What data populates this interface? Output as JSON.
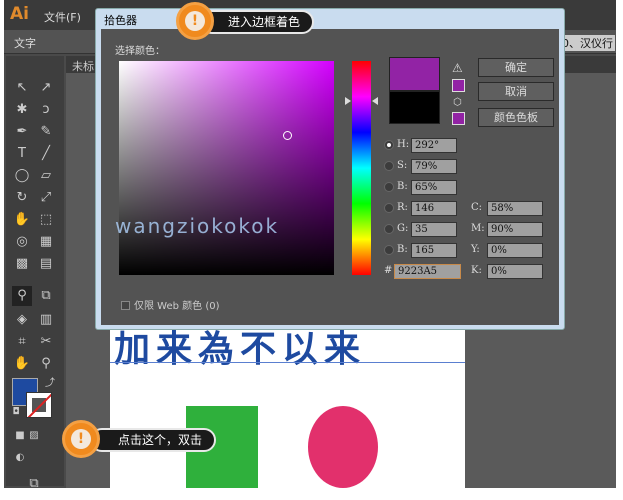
{
  "app": {
    "logo": "Ai",
    "menu_file": "文件(F)",
    "control_label": "文字",
    "font_field": "0、汉仪行",
    "doc_tab": "未标"
  },
  "canvas": {
    "text": "加来為不以来"
  },
  "dialog": {
    "title": "拾色器",
    "select_label": "选择颜色：",
    "ok": "确定",
    "cancel": "取消",
    "swatches": "颜色色板",
    "fields": {
      "H": "292°",
      "S": "79%",
      "B": "65%",
      "R": "146",
      "G": "35",
      "Bl": "165",
      "C": "58%",
      "M": "90%",
      "Y": "0%",
      "K": "0%",
      "hex": "9223A5"
    },
    "labels": {
      "H": "H:",
      "S": "S:",
      "B": "B:",
      "R": "R:",
      "G": "G:",
      "Bl": "B:",
      "C": "C:",
      "M": "M:",
      "Y": "Y:",
      "K": "K:",
      "hash": "#"
    },
    "web_only": "仅限 Web 颜色 (0)",
    "new_color": "#9223a5",
    "old_color": "#000000"
  },
  "watermark": "wangziokokok",
  "callouts": {
    "top": "进入边框着色",
    "bottom": "点击这个，双击",
    "icon": "!"
  }
}
